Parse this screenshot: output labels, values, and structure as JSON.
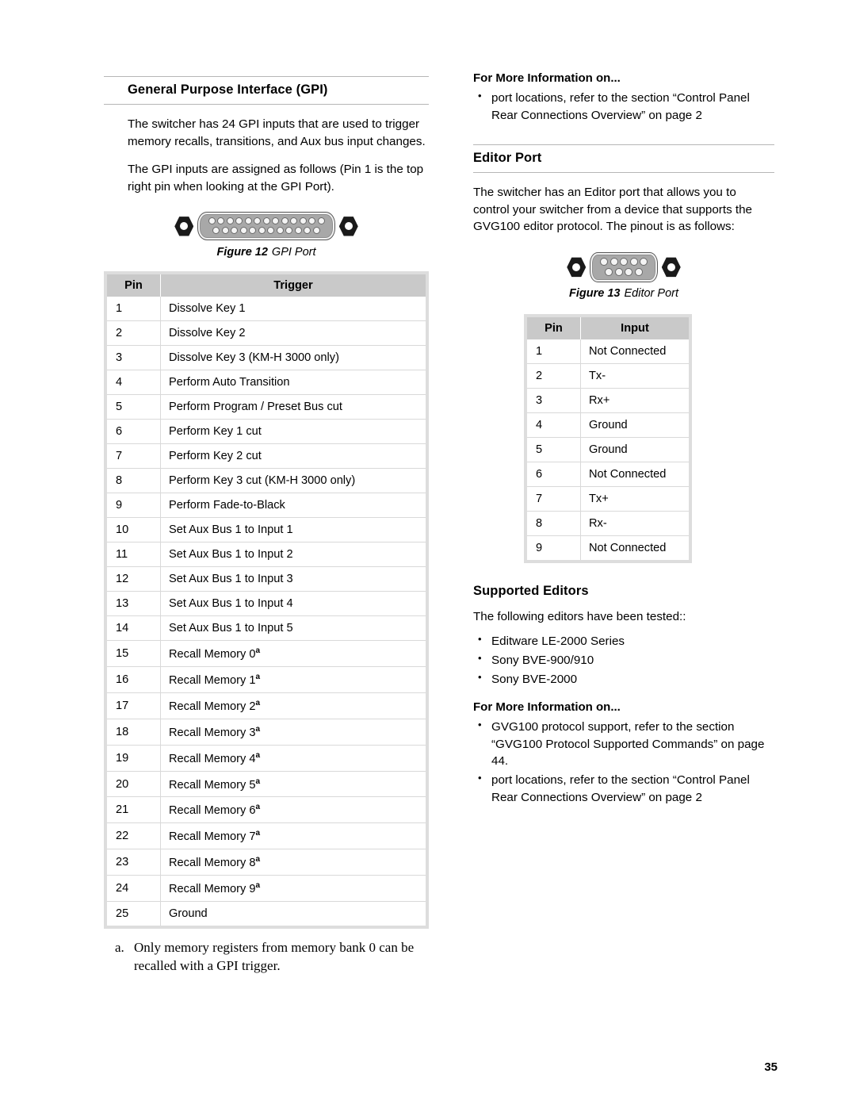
{
  "left_column": {
    "section_title": "General Purpose Interface (GPI)",
    "paragraph_1": "The switcher has 24 GPI inputs that are used to trigger memory recalls, transitions, and Aux bus input changes.",
    "paragraph_2": "The GPI inputs are assigned as follows (Pin 1 is the top right pin when looking at the GPI Port).",
    "figure": {
      "number": "Figure 12",
      "title": "GPI Port",
      "connector_type": "DB-25",
      "pins_top_row": 13,
      "pins_bottom_row": 12
    },
    "table": {
      "headers": [
        "Pin",
        "Trigger"
      ],
      "rows": [
        {
          "pin": "1",
          "trigger": "Dissolve Key 1",
          "footnote": ""
        },
        {
          "pin": "2",
          "trigger": "Dissolve Key 2",
          "footnote": ""
        },
        {
          "pin": "3",
          "trigger": "Dissolve Key 3 (KM-H 3000 only)",
          "footnote": ""
        },
        {
          "pin": "4",
          "trigger": "Perform Auto Transition",
          "footnote": ""
        },
        {
          "pin": "5",
          "trigger": "Perform Program / Preset Bus cut",
          "footnote": ""
        },
        {
          "pin": "6",
          "trigger": "Perform Key 1 cut",
          "footnote": ""
        },
        {
          "pin": "7",
          "trigger": "Perform Key 2 cut",
          "footnote": ""
        },
        {
          "pin": "8",
          "trigger": "Perform Key 3 cut (KM-H 3000 only)",
          "footnote": ""
        },
        {
          "pin": "9",
          "trigger": "Perform Fade-to-Black",
          "footnote": ""
        },
        {
          "pin": "10",
          "trigger": "Set Aux Bus 1 to Input 1",
          "footnote": ""
        },
        {
          "pin": "11",
          "trigger": "Set Aux Bus 1 to Input 2",
          "footnote": ""
        },
        {
          "pin": "12",
          "trigger": "Set Aux Bus 1 to Input 3",
          "footnote": ""
        },
        {
          "pin": "13",
          "trigger": "Set Aux Bus 1 to Input 4",
          "footnote": ""
        },
        {
          "pin": "14",
          "trigger": "Set Aux Bus 1 to Input 5",
          "footnote": ""
        },
        {
          "pin": "15",
          "trigger": "Recall Memory 0",
          "footnote": "a"
        },
        {
          "pin": "16",
          "trigger": "Recall Memory 1",
          "footnote": "a"
        },
        {
          "pin": "17",
          "trigger": "Recall Memory 2",
          "footnote": "a"
        },
        {
          "pin": "18",
          "trigger": "Recall Memory 3",
          "footnote": "a"
        },
        {
          "pin": "19",
          "trigger": "Recall Memory 4",
          "footnote": "a"
        },
        {
          "pin": "20",
          "trigger": "Recall Memory 5",
          "footnote": "a"
        },
        {
          "pin": "21",
          "trigger": "Recall Memory 6",
          "footnote": "a"
        },
        {
          "pin": "22",
          "trigger": "Recall Memory 7",
          "footnote": "a"
        },
        {
          "pin": "23",
          "trigger": "Recall Memory 8",
          "footnote": "a"
        },
        {
          "pin": "24",
          "trigger": "Recall Memory 9",
          "footnote": "a"
        },
        {
          "pin": "25",
          "trigger": "Ground",
          "footnote": ""
        }
      ]
    },
    "footnote": {
      "marker": "a.",
      "text": "Only memory registers from memory bank 0 can be recalled with a GPI trigger."
    }
  },
  "right_column": {
    "more_info_top": {
      "heading": "For More Information on...",
      "items": [
        "port locations, refer to the section “Control Panel Rear Connections Overview” on page 2"
      ]
    },
    "section_title": "Editor Port",
    "paragraph_1": "The switcher has an Editor port that allows you to control your switcher from a device that supports the GVG100 editor protocol. The pinout is as follows:",
    "figure": {
      "number": "Figure 13",
      "title": "Editor Port",
      "connector_type": "DE-9",
      "pins_top_row": 5,
      "pins_bottom_row": 4
    },
    "table": {
      "headers": [
        "Pin",
        "Input"
      ],
      "rows": [
        {
          "pin": "1",
          "input": "Not Connected"
        },
        {
          "pin": "2",
          "input": "Tx-"
        },
        {
          "pin": "3",
          "input": "Rx+"
        },
        {
          "pin": "4",
          "input": "Ground"
        },
        {
          "pin": "5",
          "input": "Ground"
        },
        {
          "pin": "6",
          "input": "Not Connected"
        },
        {
          "pin": "7",
          "input": "Tx+"
        },
        {
          "pin": "8",
          "input": "Rx-"
        },
        {
          "pin": "9",
          "input": "Not Connected"
        }
      ]
    },
    "supported_editors": {
      "heading": "Supported Editors",
      "intro": "The following editors have been tested::",
      "items": [
        "Editware LE-2000 Series",
        "Sony BVE-900/910",
        "Sony BVE-2000"
      ]
    },
    "more_info_bottom": {
      "heading": "For More Information on...",
      "items": [
        "GVG100 protocol support, refer to the section “GVG100 Protocol Supported Commands” on page 44.",
        "port locations, refer to the section “Control Panel Rear Connections Overview” on page 2"
      ]
    }
  },
  "page_number": "35",
  "colors": {
    "table_header_bg": "#c9c9c9",
    "table_frame": "#dddddd",
    "rule": "#b6b6b6",
    "connector_body": "#a8a8a8"
  }
}
